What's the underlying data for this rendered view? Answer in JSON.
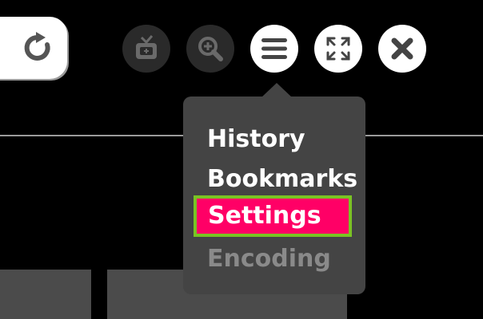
{
  "toolbar": {
    "refresh": {
      "icon": "refresh-icon"
    },
    "buttons": [
      {
        "name": "tv-icon",
        "enabled": false
      },
      {
        "name": "zoom-in-icon",
        "enabled": false
      },
      {
        "name": "menu-icon",
        "enabled": true,
        "active": true
      },
      {
        "name": "fullscreen-icon",
        "enabled": true
      },
      {
        "name": "close-icon",
        "enabled": true
      }
    ]
  },
  "menu": {
    "items": [
      {
        "label": "History",
        "state": "normal"
      },
      {
        "label": "Bookmarks",
        "state": "normal"
      },
      {
        "label": "Settings",
        "state": "selected"
      },
      {
        "label": "Encoding",
        "state": "disabled"
      }
    ]
  },
  "colors": {
    "background": "#000000",
    "menu_bg": "#444444",
    "selected_bg": "#ff0066",
    "focus_border": "#79c423",
    "disabled_text": "#8a8a8a"
  }
}
